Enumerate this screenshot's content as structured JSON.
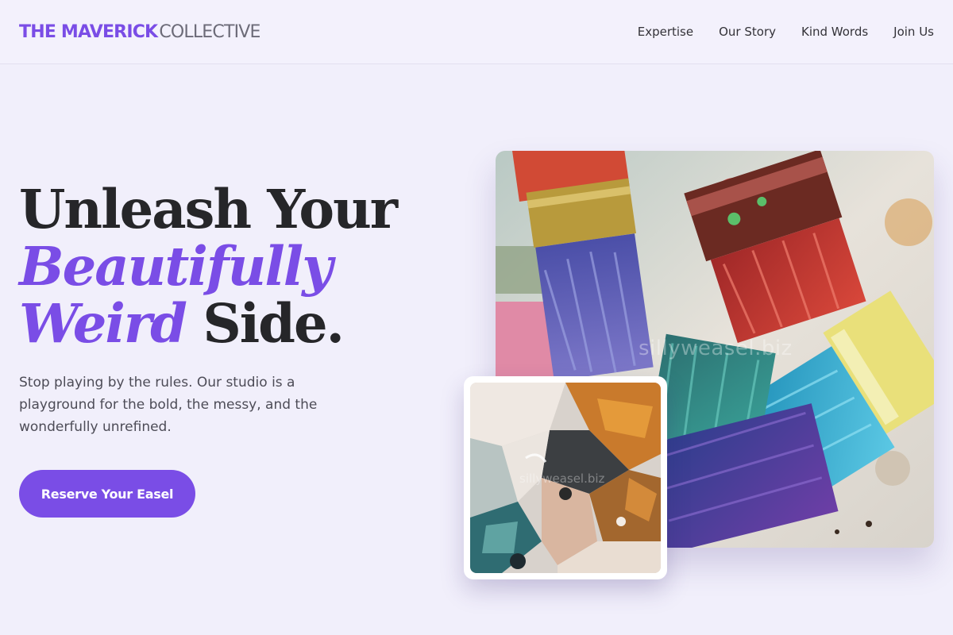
{
  "brand": {
    "strong": "THE MAVERICK",
    "light": "COLLECTIVE",
    "accent_color": "#7a4de6"
  },
  "nav": {
    "items": [
      {
        "label": "Expertise"
      },
      {
        "label": "Our Story"
      },
      {
        "label": "Kind Words"
      },
      {
        "label": "Join Us"
      }
    ]
  },
  "hero": {
    "title_line1": "Unleash Your",
    "title_accent1": "Beautifully",
    "title_accent2": "Weird",
    "title_end": "Side.",
    "subtitle": "Stop playing by the rules. Our studio is a playground for the bold, the messy, and the wonderfully unrefined.",
    "cta_label": "Reserve Your Easel"
  },
  "images": {
    "main_alt": "Paint-covered brushes on a palette",
    "main_watermark": "sillyweasel.biz",
    "inset_alt": "Close-up of thick paint texture",
    "inset_watermark": "sillyweasel.biz"
  }
}
